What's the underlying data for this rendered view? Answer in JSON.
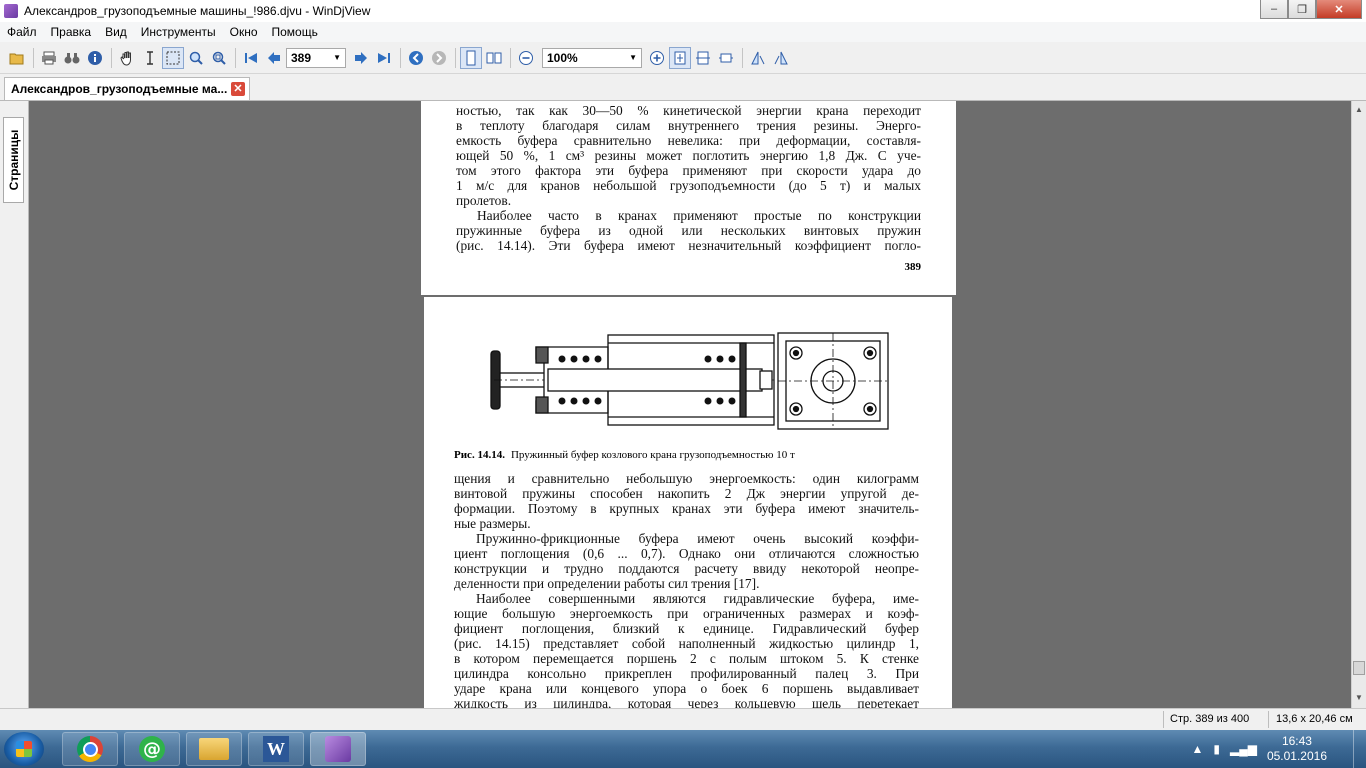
{
  "window": {
    "title": "Александров_грузоподъемные машины_!986.djvu - WinDjView",
    "minimize_glyph": "–",
    "maximize_glyph": "❐",
    "close_glyph": "✕"
  },
  "menu": [
    "Файл",
    "Правка",
    "Вид",
    "Инструменты",
    "Окно",
    "Помощь"
  ],
  "toolbar": {
    "page_value": "389",
    "zoom_value": "100%",
    "icons": {
      "open": "folder-open-icon",
      "print": "printer-icon",
      "find": "binoculars-icon",
      "info": "info-icon",
      "hand": "hand-icon",
      "select_text": "text-cursor-icon",
      "select_rect": "rect-select-icon",
      "zoom": "magnifier-icon",
      "zoom_rect": "zoom-rect-icon",
      "first": "first-page-icon",
      "prev": "prev-page-icon",
      "next": "next-page-icon",
      "last": "last-page-icon",
      "back": "back-icon",
      "forward": "forward-icon",
      "continuous": "continuous-layout-icon",
      "facing": "facing-pages-icon",
      "zoom_out": "zoom-out-icon",
      "zoom_in": "zoom-in-icon",
      "fit_page": "fit-page-icon",
      "fit_width": "fit-width-icon",
      "actual_size": "actual-size-icon",
      "rotate_left": "rotate-left-icon",
      "rotate_right": "rotate-right-icon"
    }
  },
  "tab": {
    "label": "Александров_грузоподъемные ма...",
    "close_glyph": "✕"
  },
  "side_panel": {
    "label": "Страницы"
  },
  "page389": {
    "lines": [
      "ностью, так как 30—50 % кинетической энергии крана переходит",
      "в теплоту благодаря силам внутреннего трения резины. Энерго-",
      "емкость буфера сравнительно невелика: при деформации, составля-",
      "ющей 50 %, 1 см³ резины может поглотить энергию 1,8 Дж. С уче-",
      "том этого фактора эти буфера применяют при скорости удара до",
      "1 м/с для кранов небольшой грузоподъемности (до 5 т) и малых",
      "пролетов.",
      "Наиболее часто в кранах применяют простые по конструкции",
      "пружинные буфера из одной или нескольких винтовых пружин",
      "(рис. 14.14). Эти буфера имеют незначительный коэффициент погло-"
    ],
    "page_number": "389"
  },
  "page390": {
    "caption_label": "Рис. 14.14.",
    "caption_text": "Пружинный буфер козлового крана грузоподъемностью 10 т",
    "lines": [
      "щения и сравнительно небольшую энергоемкость: один килограмм",
      "винтовой пружины способен накопить 2 Дж энергии упругой де-",
      "формации. Поэтому в крупных кранах эти буфера имеют значитель-",
      "ные размеры.",
      "Пружинно-фрикционные буфера имеют очень высокий коэффи-",
      "циент поглощения (0,6 ... 0,7). Однако они отличаются сложностью",
      "конструкции и трудно поддаются расчету ввиду некоторой неопре-",
      "деленности при определении работы сил трения [17].",
      "Наиболее совершенными являются гидравлические буфера, име-",
      "ющие большую энергоемкость при ограниченных размерах и коэф-",
      "фициент поглощения, близкий к единице. Гидравлический буфер",
      "(рис. 14.15) представляет собой наполненный жидкостью цилиндр 1,",
      "в котором перемещается поршень 2 с полым штоком 5. К стенке",
      "цилиндра консольно прикреплен профилированный палец 3. При",
      "ударе крана или концевого упора о боек 6 поршень выдавливает",
      "жидкость из цилиндра, которая через кольцевую щель перетекает"
    ]
  },
  "scrollbar": {
    "up_glyph": "▲",
    "down_glyph": "▼"
  },
  "status": {
    "page_info": "Стр. 389 из 400",
    "page_size": "13,6 x 20,46 см"
  },
  "taskbar": {
    "apps": [
      "start-button",
      "chrome-icon",
      "mail-agent-icon",
      "explorer-icon",
      "word-icon",
      "windjview-icon"
    ],
    "time": "16:43",
    "date": "05.01.2016"
  }
}
